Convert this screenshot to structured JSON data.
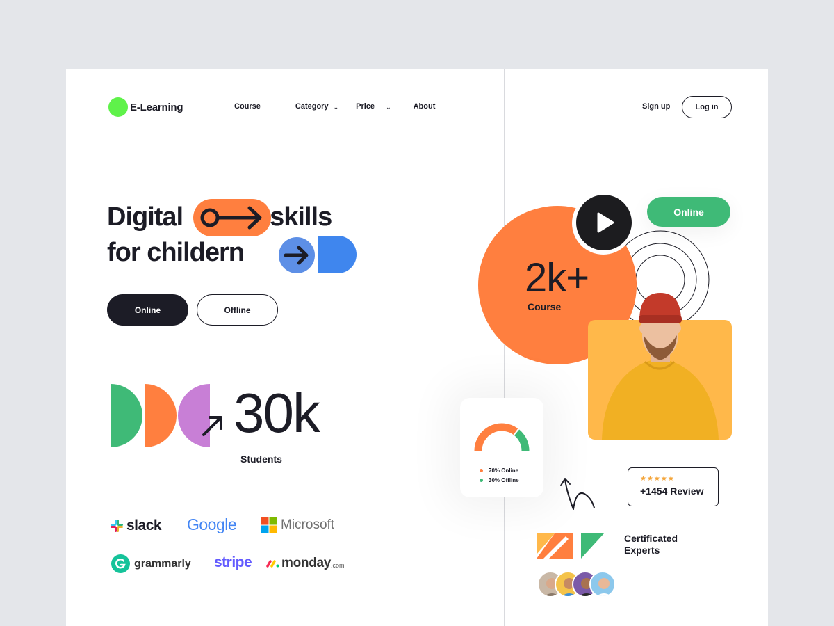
{
  "brand": {
    "name": "E-Learning"
  },
  "nav": {
    "items": [
      {
        "label": "Course"
      },
      {
        "label": "Category"
      },
      {
        "label": "Price"
      },
      {
        "label": "About"
      }
    ],
    "signup_label": "Sign up",
    "login_label": "Log in"
  },
  "hero": {
    "line1_a": "Digital",
    "line1_b": "skills",
    "line2": "for childern",
    "online_button": "Online",
    "offline_button": "Offline"
  },
  "students": {
    "count": "30k",
    "label": "Students"
  },
  "partners": {
    "slack": "slack",
    "google": "Google",
    "microsoft": "Microsoft",
    "grammarly": "grammarly",
    "stripe": "stripe",
    "monday": "monday",
    "monday_suffix": ".com"
  },
  "course": {
    "count": "2k+",
    "label": "Course",
    "online_badge": "Online"
  },
  "mode_stats": {
    "online_fraction": 0.7,
    "offline_fraction": 0.3,
    "online_label": "70% Online",
    "offline_label": "30% Offline"
  },
  "review": {
    "rating_stars": 5,
    "stars": "★★★★★",
    "text": "+1454 Review"
  },
  "certified": {
    "label": "Certificated Experts"
  },
  "colors": {
    "accent_green": "#5ff24a",
    "orange": "#ff7f3f",
    "green": "#3fba77",
    "purple": "#c87fd6",
    "blue": "#3f86ee",
    "dark": "#1c1c26",
    "yellow": "#ffb84a"
  }
}
